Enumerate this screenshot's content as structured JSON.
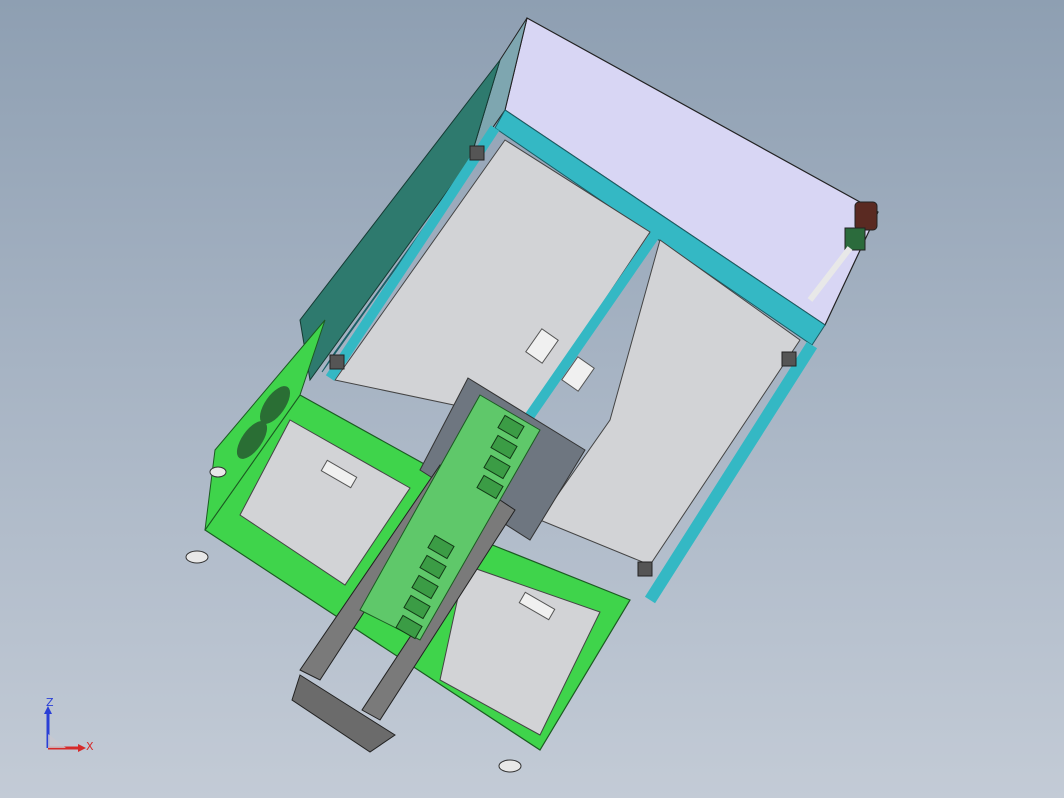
{
  "viewport": {
    "background_top": "#8e9fb2",
    "background_bottom": "#c3cbd6"
  },
  "model": {
    "frame_color_primary": "#3fd44b",
    "frame_color_secondary": "#34b8c4",
    "panel_color": "#d2d3d6",
    "top_cover_color": "#d8d6f4",
    "conveyor_color": "#5fc86a",
    "roller_color": "#6b6b6b"
  },
  "triad": {
    "z_label": "Z",
    "x_label": "X",
    "z_color": "#2a3fd6",
    "x_color": "#d62a2a"
  }
}
